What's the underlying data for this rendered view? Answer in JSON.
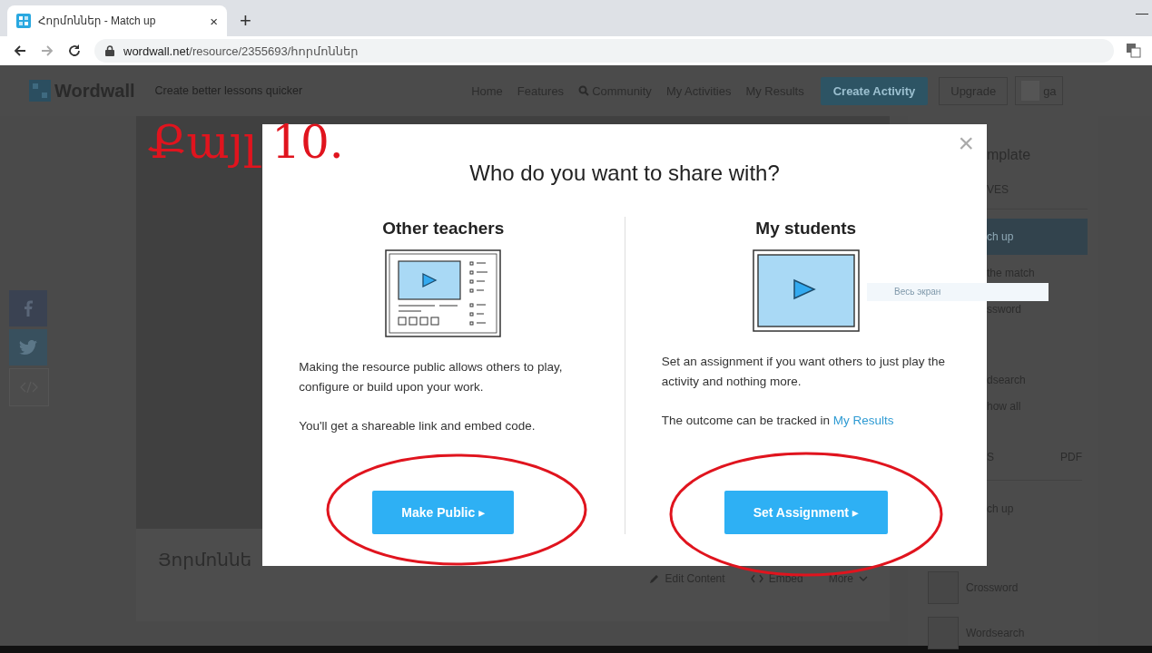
{
  "browser": {
    "tab_title": "Հորմոններ - Match up",
    "tab_close": "×",
    "new_tab": "+",
    "minimize": "—",
    "url_domain": "wordwall.net",
    "url_path": "/resource/2355693/հորմոններ"
  },
  "header": {
    "logo": "Wordwall",
    "tagline": "Create better lessons quicker",
    "nav": [
      {
        "label": "Home",
        "search": false
      },
      {
        "label": "Features",
        "search": false
      },
      {
        "label": "Community",
        "search": true
      },
      {
        "label": "My Activities",
        "search": false
      },
      {
        "label": "My Results",
        "search": false
      }
    ],
    "create_button": "Create Activity",
    "upgrade_button": "Upgrade",
    "user": "ga"
  },
  "activity": {
    "title": "Յորմոննե",
    "actions": [
      {
        "label": "Edit Content",
        "kind": "pencil"
      },
      {
        "label": "Embed",
        "kind": "code"
      },
      {
        "label": "More",
        "kind": "caret"
      }
    ]
  },
  "sidebar": {
    "title": "mplate",
    "tabs_label": "VES",
    "templates": [
      {
        "label": "ch up",
        "selected": true
      },
      {
        "label": "the match",
        "selected": false
      },
      {
        "label": "ssword",
        "selected": false
      },
      {
        "label": "dsearch",
        "selected": false
      }
    ],
    "show_all": "how all",
    "formats": [
      "S",
      "PDF"
    ],
    "current": "ch up",
    "related": [
      "Crossword",
      "Wordsearch"
    ]
  },
  "annotation": "Քայլ 10.",
  "tooltip": "Весь экран",
  "modal": {
    "title": "Who do you want to share with?",
    "close": "×",
    "columns": [
      {
        "heading": "Other teachers",
        "paragraphs": [
          {
            "text": "Making the resource public allows others to play, configure or build upon your work."
          },
          {
            "text": "You'll get a shareable link and embed code."
          }
        ],
        "button": "Make Public ▸"
      },
      {
        "heading": "My students",
        "paragraphs": [
          {
            "text": "Set an assignment if you want others to just play the activity and nothing more."
          },
          {
            "text": "The outcome can be tracked in ",
            "link": "My Results"
          }
        ],
        "button": "Set Assignment ▸"
      }
    ]
  }
}
